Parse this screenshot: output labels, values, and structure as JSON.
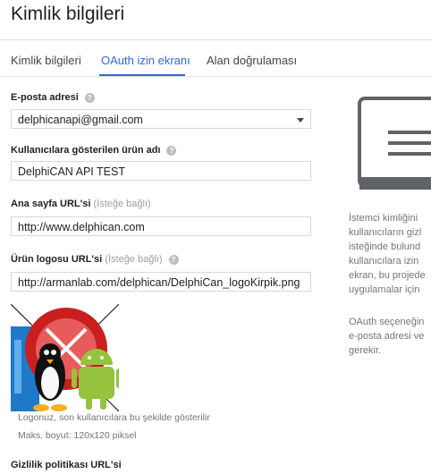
{
  "page": {
    "title": "Kimlik bilgileri"
  },
  "tabs": [
    {
      "label": "Kimlik bilgileri"
    },
    {
      "label": "OAuth izin ekranı"
    },
    {
      "label": "Alan doğrulaması"
    }
  ],
  "form": {
    "email": {
      "label": "E-posta adresi",
      "value": "delphicanapi@gmail.com"
    },
    "product_name": {
      "label": "Kullanıcılara gösterilen ürün adı",
      "value": "DelphiCAN API TEST"
    },
    "homepage_url": {
      "label": "Ana sayfa URL'si",
      "optional": "(İsteğe bağlı)",
      "value": "http://www.delphican.com"
    },
    "logo_url": {
      "label": "Ürün logosu URL'si",
      "optional": "(İsteğe bağlı)",
      "value": "http://armanlab.com/delphican/DelphiCan_logoKirpik.png"
    },
    "logo_hint": "Logonuz, son kullanıcılara bu şekilde gösterilir",
    "logo_size_hint": "Maks. boyut: 120x120 piksel",
    "privacy_label": "Gizlilik politikası URL'si"
  },
  "side": {
    "paragraph1": [
      "İstemci kimliğini",
      "kullanıcıların gizl",
      "isteğinde bulund",
      "kullanıcılara izin",
      "ekran, bu projede",
      "uygulamalar için"
    ],
    "paragraph2": [
      "OAuth seçeneğin",
      "e-posta adresi ve",
      "gerekir."
    ]
  },
  "colors": {
    "accent": "#3367d6",
    "border": "#d9d9d9",
    "muted": "#757575"
  },
  "icons": {
    "help": "help-circle-icon",
    "dropdown": "chevron-down-icon",
    "laptop": "laptop-consent-screen-icon"
  }
}
